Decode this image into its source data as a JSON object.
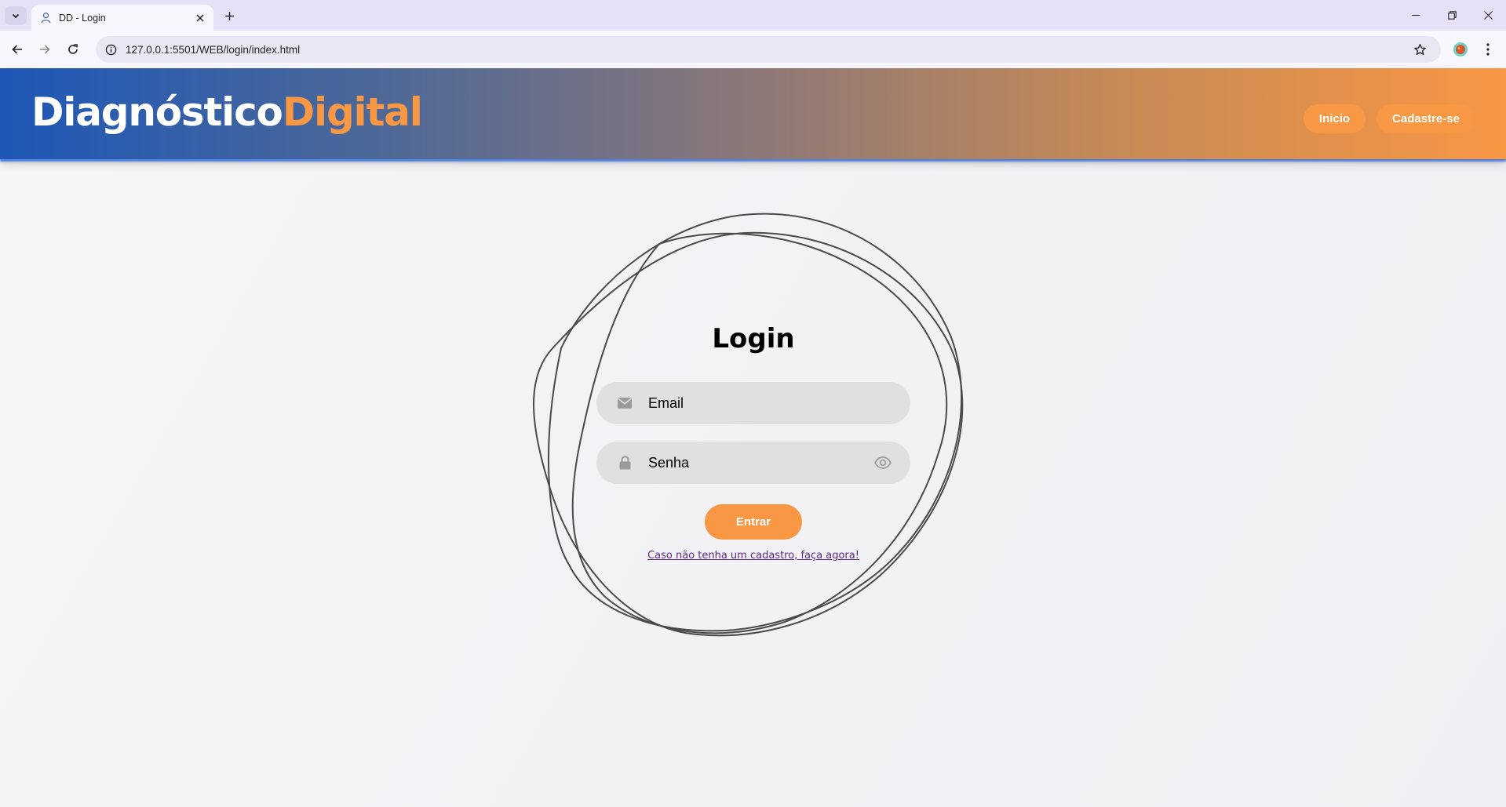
{
  "browser": {
    "tab_title": "DD - Login",
    "url": "127.0.0.1:5501/WEB/login/index.html"
  },
  "header": {
    "brand_part1": "Diagnóstico",
    "brand_part2": "Digital",
    "nav": {
      "home_label": "Inicio",
      "signup_label": "Cadastre-se"
    }
  },
  "login": {
    "title": "Login",
    "email_placeholder": "Email",
    "password_placeholder": "Senha",
    "submit_label": "Entrar",
    "signup_link": "Caso não tenha um cadastro, faça agora!"
  },
  "icons": {
    "email": "envelope-icon",
    "password": "lock-icon",
    "toggle_password": "eye-icon"
  },
  "colors": {
    "accent": "#f89744",
    "brand_blue": "#1d57b7",
    "field_bg": "#e0e0e0",
    "link": "#5b2a86"
  }
}
